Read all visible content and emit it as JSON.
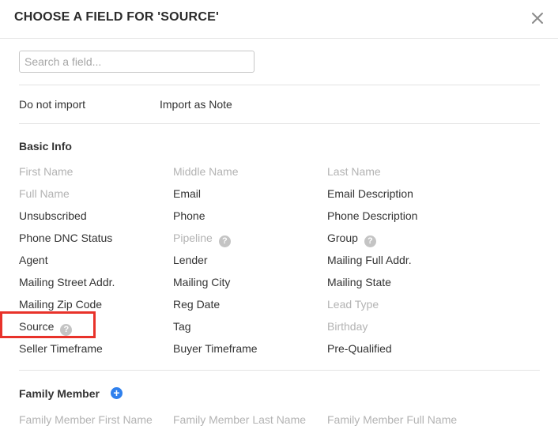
{
  "dialog": {
    "title": "CHOOSE A FIELD FOR 'SOURCE'",
    "search_placeholder": "Search a field..."
  },
  "quick_options": [
    "Do not import",
    "Import as Note"
  ],
  "basic_info": {
    "title": "Basic Info",
    "rows": [
      [
        {
          "label": "First Name",
          "disabled": true
        },
        {
          "label": "Middle Name",
          "disabled": true
        },
        {
          "label": "Last Name",
          "disabled": true
        }
      ],
      [
        {
          "label": "Full Name",
          "disabled": true
        },
        {
          "label": "Email"
        },
        {
          "label": "Email Description"
        }
      ],
      [
        {
          "label": "Unsubscribed"
        },
        {
          "label": "Phone"
        },
        {
          "label": "Phone Description"
        }
      ],
      [
        {
          "label": "Phone DNC Status"
        },
        {
          "label": "Pipeline",
          "disabled": true,
          "help": true
        },
        {
          "label": "Group",
          "help": true
        }
      ],
      [
        {
          "label": "Agent"
        },
        {
          "label": "Lender"
        },
        {
          "label": "Mailing Full Addr."
        }
      ],
      [
        {
          "label": "Mailing Street Addr."
        },
        {
          "label": "Mailing City"
        },
        {
          "label": "Mailing State"
        }
      ],
      [
        {
          "label": "Mailing Zip Code"
        },
        {
          "label": "Reg Date"
        },
        {
          "label": "Lead Type",
          "disabled": true
        }
      ],
      [
        {
          "label": "Source",
          "help": true
        },
        {
          "label": "Tag"
        },
        {
          "label": "Birthday",
          "disabled": true
        }
      ],
      [
        {
          "label": "Seller Timeframe"
        },
        {
          "label": "Buyer Timeframe"
        },
        {
          "label": "Pre-Qualified"
        }
      ]
    ]
  },
  "family_member": {
    "title": "Family Member",
    "row": [
      {
        "label": "Family Member First Name",
        "disabled": true
      },
      {
        "label": "Family Member Last Name",
        "disabled": true
      },
      {
        "label": "Family Member Full Name",
        "disabled": true
      }
    ]
  },
  "colors": {
    "highlight": "#e8322a",
    "add_button": "#2f80ed",
    "disabled_text": "#b3b3b3"
  },
  "icons": {
    "close": "close-icon",
    "help": "question-mark-icon",
    "add": "plus-circle-icon"
  }
}
